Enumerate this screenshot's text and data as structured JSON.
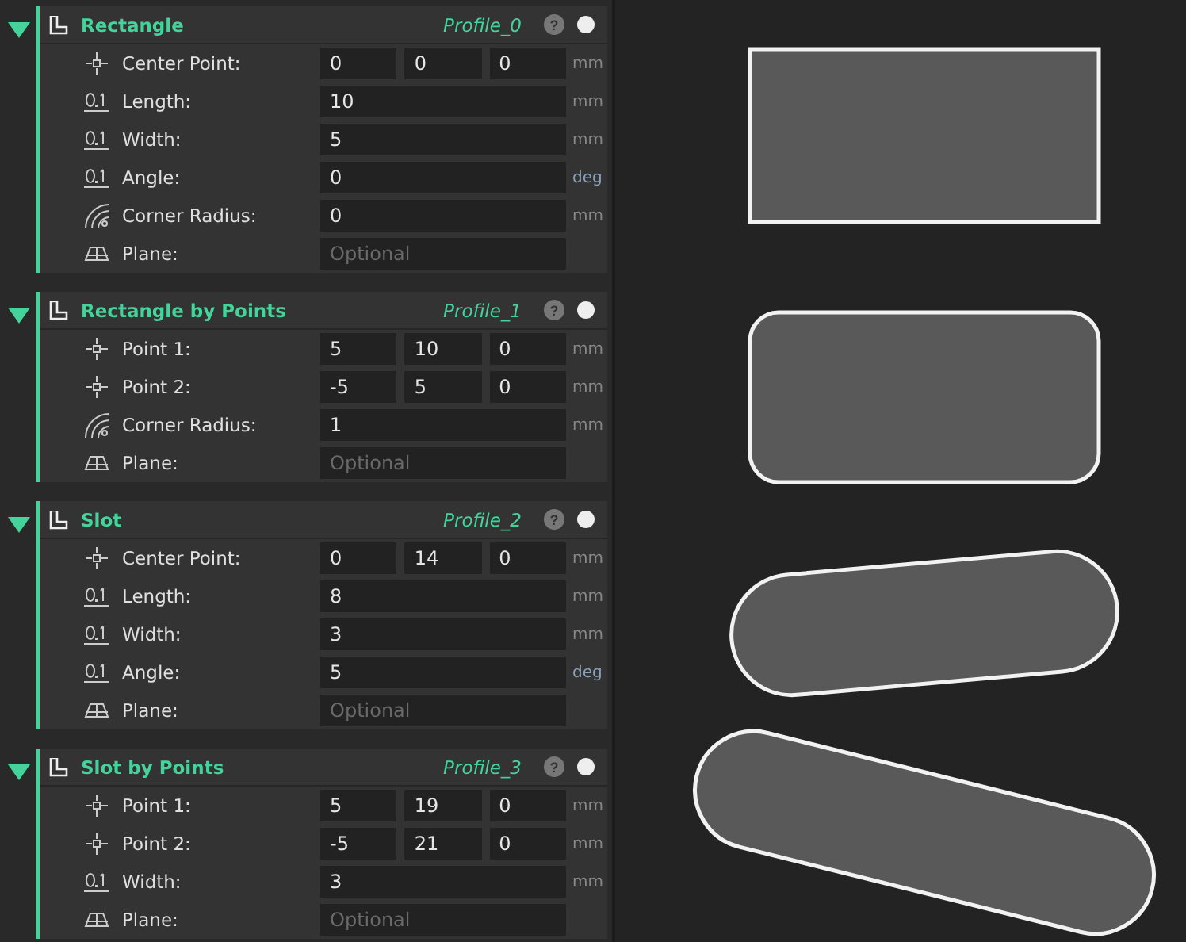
{
  "profiles": [
    {
      "title": "Rectangle",
      "name": "Profile_0",
      "expanded": true,
      "help": "?",
      "rows": [
        {
          "kind": "point",
          "label": "Center Point:",
          "values": [
            "0",
            "0",
            "0"
          ],
          "unit": "mm"
        },
        {
          "kind": "number",
          "label": "Length:",
          "values": [
            "10"
          ],
          "unit": "mm"
        },
        {
          "kind": "number",
          "label": "Width:",
          "values": [
            "5"
          ],
          "unit": "mm"
        },
        {
          "kind": "number",
          "label": "Angle:",
          "values": [
            "0"
          ],
          "unit": "deg"
        },
        {
          "kind": "radius",
          "label": "Corner Radius:",
          "values": [
            "0"
          ],
          "unit": "mm"
        },
        {
          "kind": "plane",
          "label": "Plane:",
          "placeholder": "Optional"
        }
      ]
    },
    {
      "title": "Rectangle by Points",
      "name": "Profile_1",
      "expanded": true,
      "help": "?",
      "rows": [
        {
          "kind": "point",
          "label": "Point 1:",
          "values": [
            "5",
            "10",
            "0"
          ],
          "unit": "mm"
        },
        {
          "kind": "point",
          "label": "Point 2:",
          "values": [
            "-5",
            "5",
            "0"
          ],
          "unit": "mm"
        },
        {
          "kind": "radius",
          "label": "Corner Radius:",
          "values": [
            "1"
          ],
          "unit": "mm"
        },
        {
          "kind": "plane",
          "label": "Plane:",
          "placeholder": "Optional"
        }
      ]
    },
    {
      "title": "Slot",
      "name": "Profile_2",
      "expanded": true,
      "help": "?",
      "rows": [
        {
          "kind": "point",
          "label": "Center Point:",
          "values": [
            "0",
            "14",
            "0"
          ],
          "unit": "mm"
        },
        {
          "kind": "number",
          "label": "Length:",
          "values": [
            "8"
          ],
          "unit": "mm"
        },
        {
          "kind": "number",
          "label": "Width:",
          "values": [
            "3"
          ],
          "unit": "mm"
        },
        {
          "kind": "number",
          "label": "Angle:",
          "values": [
            "5"
          ],
          "unit": "deg"
        },
        {
          "kind": "plane",
          "label": "Plane:",
          "placeholder": "Optional"
        }
      ]
    },
    {
      "title": "Slot by Points",
      "name": "Profile_3",
      "expanded": true,
      "help": "?",
      "rows": [
        {
          "kind": "point",
          "label": "Point 1:",
          "values": [
            "5",
            "19",
            "0"
          ],
          "unit": "mm"
        },
        {
          "kind": "point",
          "label": "Point 2:",
          "values": [
            "-5",
            "21",
            "0"
          ],
          "unit": "mm"
        },
        {
          "kind": "number",
          "label": "Width:",
          "values": [
            "3"
          ],
          "unit": "mm"
        },
        {
          "kind": "plane",
          "label": "Plane:",
          "placeholder": "Optional"
        }
      ]
    }
  ]
}
